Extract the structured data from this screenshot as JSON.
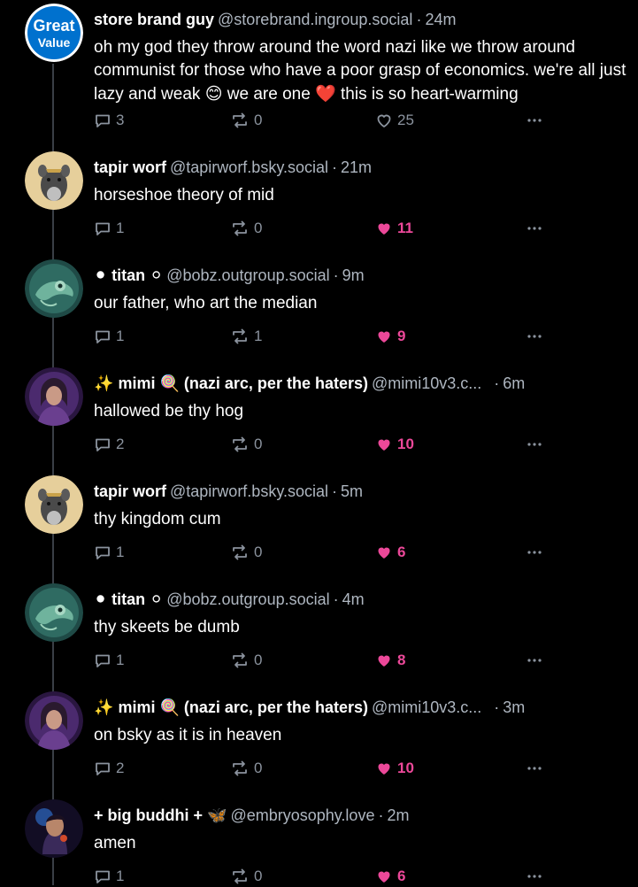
{
  "posts": [
    {
      "display_name": "store brand guy",
      "handle": "@storebrand.ingroup.social",
      "time": "24m",
      "text_parts": [
        "oh my god they throw around the word nazi like we throw around communist for those who have a poor grasp of economics. we're all just lazy and weak ",
        "😊",
        " we are one ",
        "❤️",
        " this is so heart-warming"
      ],
      "replies": "3",
      "reposts": "0",
      "likes": "25",
      "liked": false,
      "avatar": "great-value-logo",
      "avatar_text": [
        "Great",
        "Value"
      ]
    },
    {
      "display_name": "tapir worf",
      "handle": "@tapirworf.bsky.social",
      "time": "21m",
      "text": "horseshoe theory of mid",
      "replies": "1",
      "reposts": "0",
      "likes": "11",
      "liked": true,
      "avatar": "tapir-avatar"
    },
    {
      "name_prefix": "⚫",
      "display_name": "titan",
      "name_suffix": "⚪",
      "handle": "@bobz.outgroup.social",
      "time": "9m",
      "text": "our father, who art the median",
      "replies": "1",
      "reposts": "1",
      "likes": "9",
      "liked": true,
      "avatar": "chameleon-avatar"
    },
    {
      "name_prefix": "✨",
      "display_name": "mimi",
      "name_suffix": "🍭",
      "name_rest": "(nazi arc, per the haters)",
      "handle": "@mimi10v3.c...",
      "time": "6m",
      "text": "hallowed be thy hog",
      "replies": "2",
      "reposts": "0",
      "likes": "10",
      "liked": true,
      "avatar": "mimi-avatar"
    },
    {
      "display_name": "tapir worf",
      "handle": "@tapirworf.bsky.social",
      "time": "5m",
      "text": "thy kingdom cum",
      "replies": "1",
      "reposts": "0",
      "likes": "6",
      "liked": true,
      "avatar": "tapir-avatar"
    },
    {
      "name_prefix": "⚫",
      "display_name": "titan",
      "name_suffix": "⚪",
      "handle": "@bobz.outgroup.social",
      "time": "4m",
      "text": "thy skeets be dumb",
      "replies": "1",
      "reposts": "0",
      "likes": "8",
      "liked": true,
      "avatar": "chameleon-avatar"
    },
    {
      "name_prefix": "✨",
      "display_name": "mimi",
      "name_suffix": "🍭",
      "name_rest": "(nazi arc, per the haters)",
      "handle": "@mimi10v3.c...",
      "time": "3m",
      "text": "on bsky as it is in heaven",
      "replies": "2",
      "reposts": "0",
      "likes": "10",
      "liked": true,
      "avatar": "mimi-avatar"
    },
    {
      "display_name": "+ big buddhi +",
      "name_suffix": "🦋",
      "handle": "@embryosophy.love",
      "time": "2m",
      "text": "amen",
      "replies": "1",
      "reposts": "0",
      "likes": "6",
      "liked": true,
      "avatar": "buddhi-avatar"
    }
  ],
  "colors": {
    "background": "#000000",
    "muted": "#8b939e",
    "like_active": "#ec4899",
    "thread_line": "#3a3f46"
  }
}
